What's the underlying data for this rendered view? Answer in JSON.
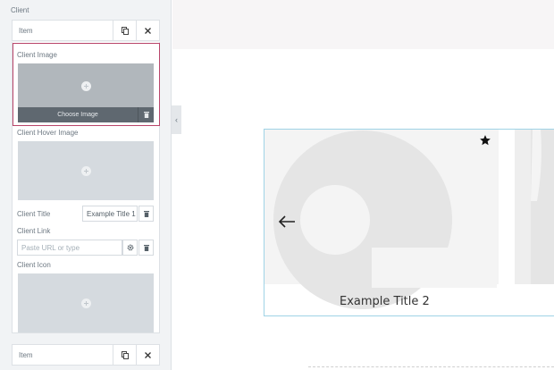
{
  "panel": {
    "section_label": "Client",
    "item_label": "Item",
    "fields": {
      "client_image_label": "Client Image",
      "choose_image_label": "Choose Image",
      "client_hover_image_label": "Client Hover Image",
      "client_title_label": "Client Title",
      "client_title_value": "Example Title 1",
      "client_link_label": "Client Link",
      "client_link_placeholder": "Paste URL or type",
      "client_icon_label": "Client Icon"
    },
    "next_item_label": "Item"
  },
  "preview": {
    "slide_title": "Example Title 2"
  },
  "colors": {
    "highlight": "#b9456a",
    "card_border": "#9fd3e6"
  },
  "icons": [
    "copy-icon",
    "close-icon",
    "trash-icon",
    "gear-icon",
    "chevron-left-icon",
    "arrow-left-icon",
    "star-icon",
    "plus-icon"
  ]
}
